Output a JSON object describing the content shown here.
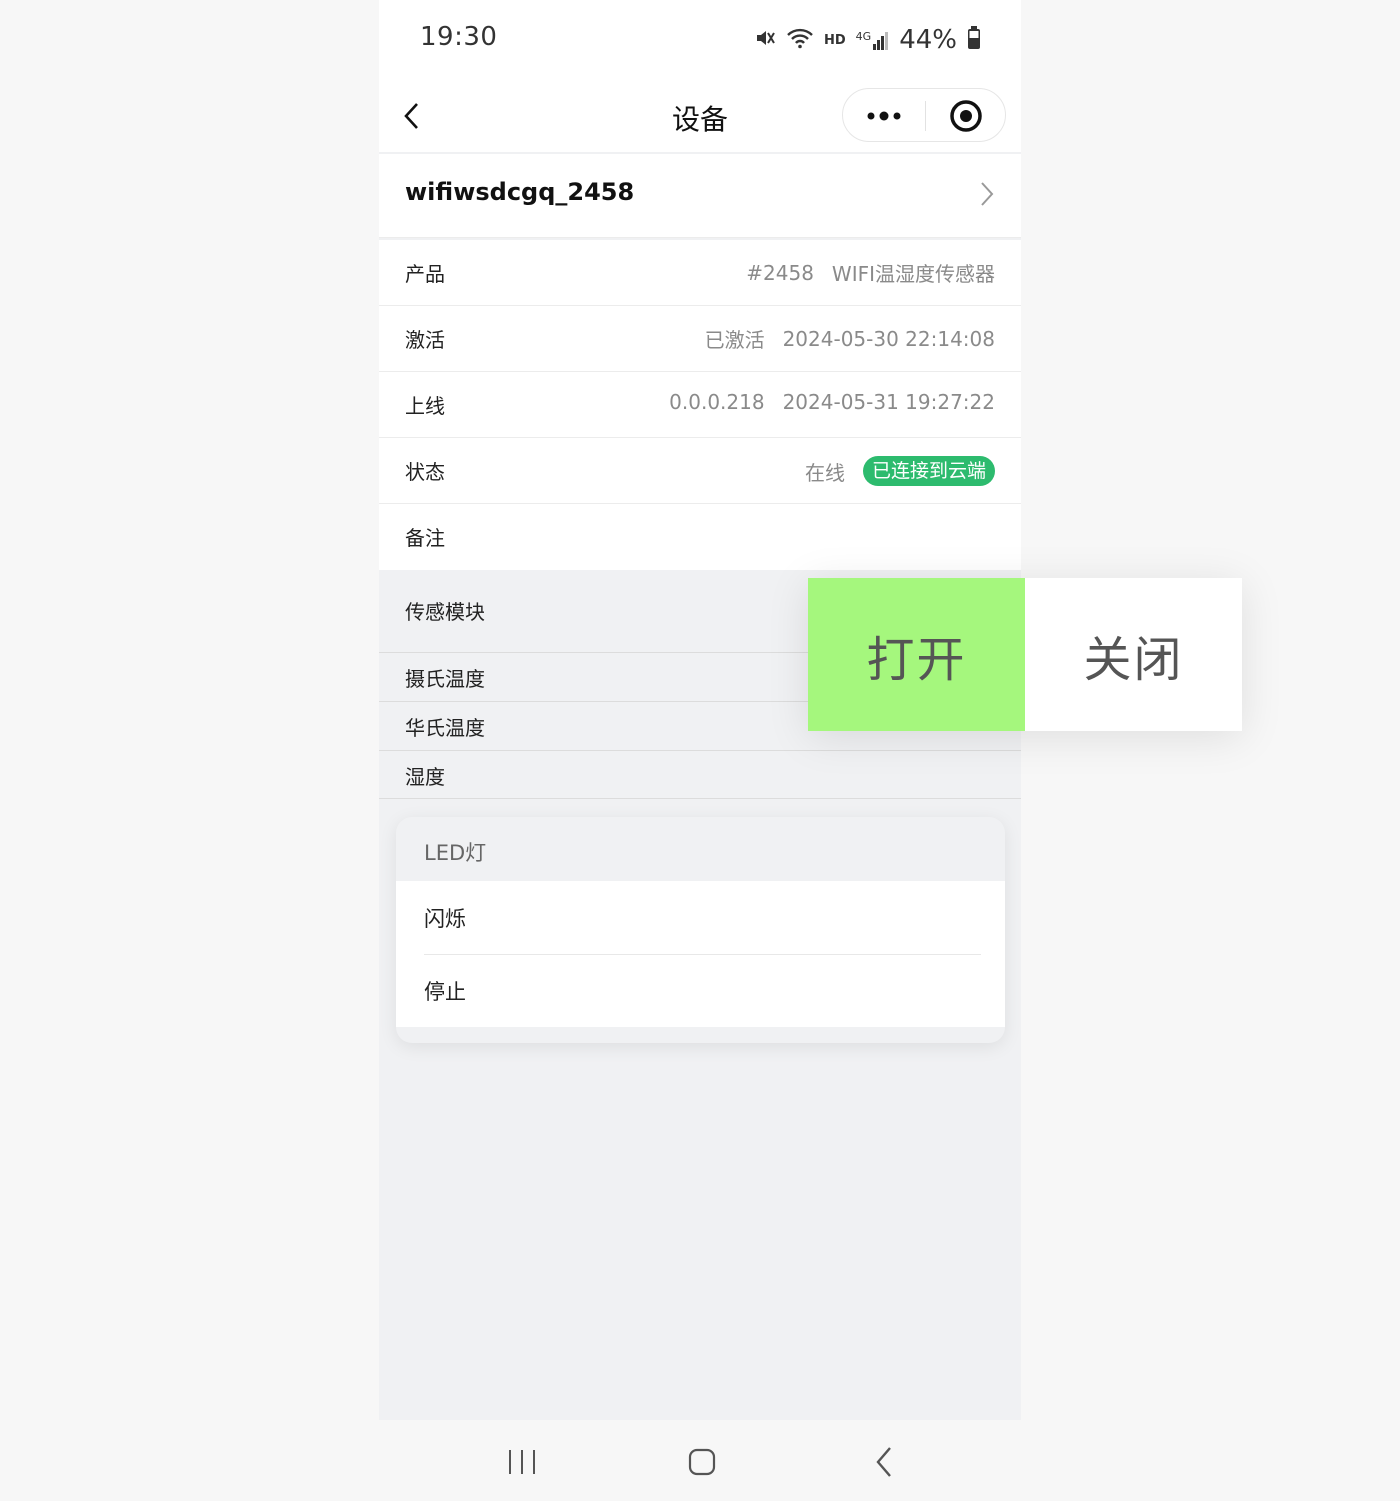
{
  "status_bar": {
    "time": "19:30",
    "battery": "44%",
    "network_label": "HD",
    "signal_label": "4G",
    "icons": [
      "mute-icon",
      "wifi-icon",
      "signal-icon",
      "battery-icon"
    ]
  },
  "nav": {
    "title": "设备",
    "back_icon": "chevron-left-icon",
    "menu_icon": "more-dots-icon",
    "close_icon": "target-circle-icon"
  },
  "device": {
    "name": "wifiwsdcgq_2458"
  },
  "info_rows": [
    {
      "label": "产品",
      "values": [
        "#2458",
        "WIFI温湿度传感器"
      ]
    },
    {
      "label": "激活",
      "values": [
        "已激活",
        "2024-05-30 22:14:08"
      ]
    },
    {
      "label": "上线",
      "values": [
        "0.0.0.218",
        "2024-05-31 19:27:22"
      ]
    },
    {
      "label": "状态",
      "values": [
        "在线"
      ],
      "badge": "已连接到云端"
    },
    {
      "label": "备注",
      "values": []
    }
  ],
  "sensor": {
    "title": "传感模块",
    "items": [
      "摄氏温度",
      "华氏温度",
      "湿度"
    ]
  },
  "led": {
    "title": "LED灯",
    "items": [
      "闪烁",
      "停止"
    ]
  },
  "popup": {
    "on_label": "打开",
    "off_label": "关闭"
  },
  "colors": {
    "badge_green": "#2dbb6e",
    "on_green": "#a5f77d",
    "page_gray": "#f0f1f3"
  }
}
